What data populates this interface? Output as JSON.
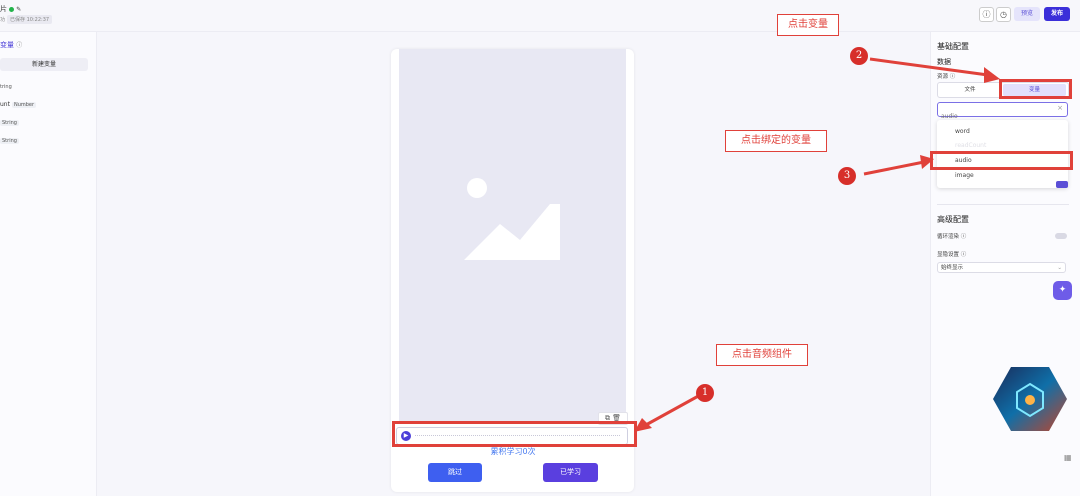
{
  "header": {
    "title": "片",
    "subtitle": "功",
    "saved_status": "已保存 10:22:37",
    "preview_label": "预览",
    "publish_label": "发布"
  },
  "left_panel": {
    "title": "变量",
    "new_variable_label": "新建变量",
    "variables": [
      {
        "name": "",
        "type": "tring"
      },
      {
        "name": "unt",
        "type": "Number"
      },
      {
        "name": "",
        "type": "String"
      },
      {
        "name": "",
        "type": "String"
      }
    ]
  },
  "canvas": {
    "counter_text": "累积学习0次",
    "skip_label": "跳过",
    "learned_label": "已学习"
  },
  "right_panel": {
    "basic_config_title": "基础配置",
    "data_title": "数据",
    "resource_label": "资源",
    "segment_options": [
      "文件",
      "变量"
    ],
    "selected_segment": "变量",
    "select_value": "audio",
    "dropdown_options": [
      "word",
      "readCount",
      "audio",
      "image"
    ],
    "advanced_config_title": "高级配置",
    "loop_render_label": "循环渲染",
    "visibility_label": "显隐设置",
    "visibility_value": "始终显示"
  },
  "annotations": {
    "step1": {
      "number": "1",
      "text": "点击音频组件"
    },
    "step2": {
      "number": "2",
      "text": "点击变量"
    },
    "step3": {
      "number": "3",
      "text": "点击绑定的变量"
    }
  },
  "colors": {
    "accent": "#4b3fd8",
    "publish": "#3b2fd9",
    "annotation_red": "#e0413a",
    "skip_button": "#3e5ff0",
    "learned_button": "#5a3fdf"
  }
}
